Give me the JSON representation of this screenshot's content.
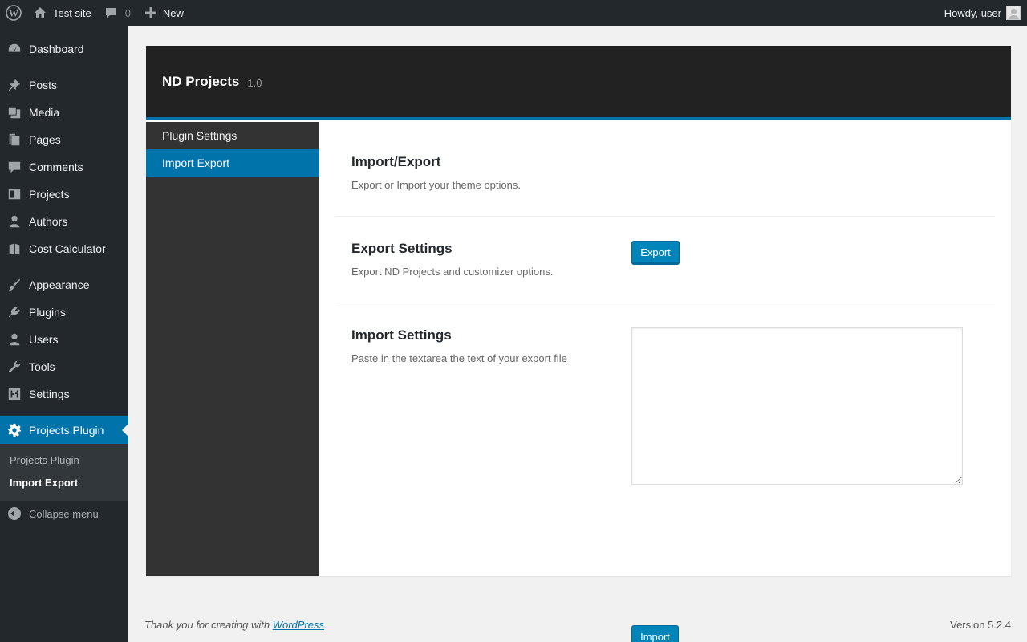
{
  "adminbar": {
    "site_name": "Test site",
    "comment_count": "0",
    "new_label": "New",
    "howdy": "Howdy, user"
  },
  "menu": {
    "items": [
      {
        "label": "Dashboard",
        "icon": "dashboard-icon"
      },
      {
        "label": "Posts",
        "icon": "pin-icon"
      },
      {
        "label": "Media",
        "icon": "media-icon"
      },
      {
        "label": "Pages",
        "icon": "pages-icon"
      },
      {
        "label": "Comments",
        "icon": "comment-icon"
      },
      {
        "label": "Projects",
        "icon": "projects-icon"
      },
      {
        "label": "Authors",
        "icon": "user-icon"
      },
      {
        "label": "Cost Calculator",
        "icon": "calculator-icon"
      },
      {
        "label": "Appearance",
        "icon": "brush-icon"
      },
      {
        "label": "Plugins",
        "icon": "plug-icon"
      },
      {
        "label": "Users",
        "icon": "user-icon"
      },
      {
        "label": "Tools",
        "icon": "wrench-icon"
      },
      {
        "label": "Settings",
        "icon": "sliders-icon"
      },
      {
        "label": "Projects Plugin",
        "icon": "gear-icon"
      }
    ],
    "submenu": [
      "Projects Plugin",
      "Import Export"
    ],
    "collapse": "Collapse menu"
  },
  "panel": {
    "title": "ND Projects",
    "version": "1.0",
    "tabs": [
      "Plugin Settings",
      "Import Export"
    ],
    "sections": {
      "intro": {
        "title": "Import/Export",
        "desc": "Export or Import your theme options."
      },
      "export": {
        "title": "Export Settings",
        "desc": "Export ND Projects and customizer options.",
        "button": "Export"
      },
      "import": {
        "title": "Import Settings",
        "desc": "Paste in the textarea the text of your export file",
        "textarea": "",
        "button": "Import"
      }
    }
  },
  "footer": {
    "thanks_prefix": "Thank you for creating with ",
    "thanks_link": "WordPress",
    "thanks_suffix": ".",
    "version": "Version 5.2.4"
  },
  "colors": {
    "accent": "#0073aa",
    "button": "#0085ba",
    "menu_bg": "#23282d"
  }
}
